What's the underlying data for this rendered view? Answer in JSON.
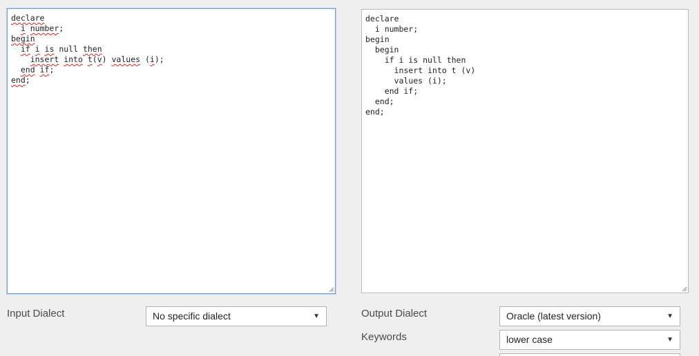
{
  "input_editor": {
    "lines": [
      "declare",
      "  i number;",
      "begin",
      "  if i is null then",
      "    insert into t(v) values (i);",
      "  end if;",
      "end;"
    ]
  },
  "output_editor": {
    "lines": [
      "declare",
      "  i number;",
      "begin",
      "  begin",
      "    if i is null then",
      "      insert into t (v)",
      "      values (i);",
      "    end if;",
      "  end;",
      "end;"
    ]
  },
  "input_dialect": {
    "label": "Input Dialect",
    "selected": "No specific dialect"
  },
  "output_dialect": {
    "label": "Output Dialect",
    "selected": "Oracle (latest version)"
  },
  "keywords": {
    "label": "Keywords",
    "selected": "lower case"
  },
  "icons": {
    "dropdown": "caret-down-icon",
    "resize": "resize-grip-icon"
  },
  "colors": {
    "focus_border": "#6e9ee6",
    "spellcheck": "#e3221b",
    "background": "#efefef"
  }
}
